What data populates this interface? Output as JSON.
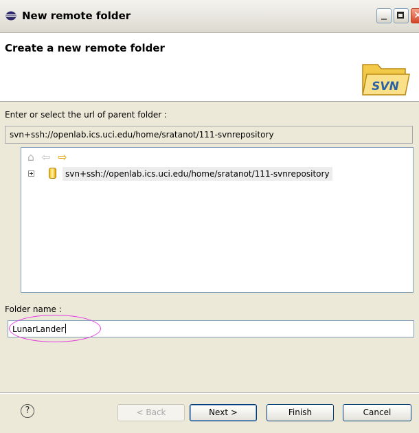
{
  "window": {
    "title": "New remote folder",
    "icon": "eclipse-icon"
  },
  "banner": {
    "heading": "Create a new remote folder",
    "icon_text": "SVN"
  },
  "parent_folder": {
    "label": "Enter or select the url of parent folder :",
    "url": "svn+ssh://openlab.ics.uci.edu/home/sratanot/111-svnrepository"
  },
  "tree": {
    "toolbar": [
      "home-icon",
      "back-arrow-icon",
      "forward-arrow-icon"
    ],
    "items": [
      {
        "label": "svn+ssh://openlab.ics.uci.edu/home/sratanot/111-svnrepository",
        "expanded": false,
        "selected": true
      }
    ]
  },
  "folder_name": {
    "label": "Folder name :",
    "value": "LunarLander"
  },
  "buttons": {
    "help": "?",
    "back": "< Back",
    "next": "Next >",
    "finish": "Finish",
    "cancel": "Cancel"
  },
  "colors": {
    "dialog_bg": "#ece9d8",
    "highlight_ellipse": "#e23ae2",
    "forward_arrow": "#e0a100"
  }
}
